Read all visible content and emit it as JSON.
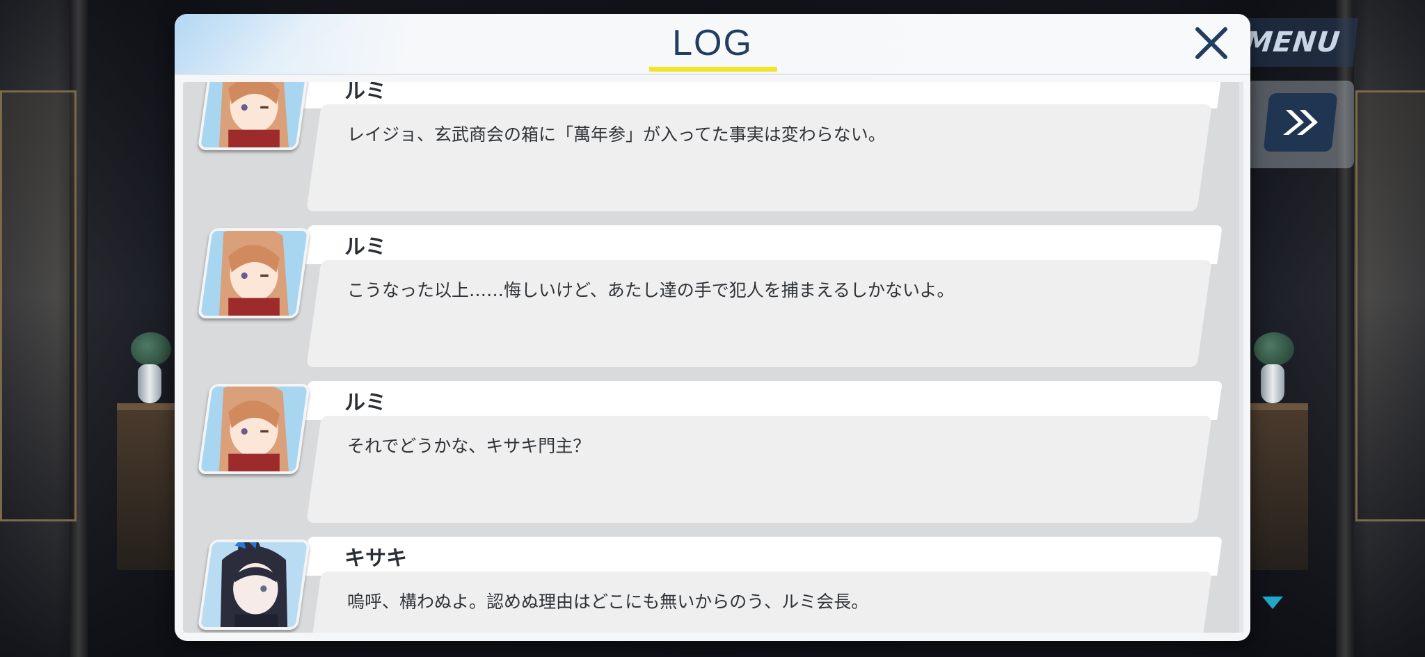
{
  "scene": {
    "background": "dimmed palace interior"
  },
  "hud": {
    "menu_label": "MENU",
    "fast_forward_icon": "double-chevron-right-icon",
    "scroll_indicator_icon": "triangle-down-icon"
  },
  "log": {
    "title": "LOG",
    "close_icon": "close-icon",
    "accent_color": "#f3e32c",
    "title_color": "#223e5f",
    "entries": [
      {
        "speaker": "ルミ",
        "message": "レイジョ、玄武商会の箱に「萬年参」が入ってた事実は変わらない。"
      },
      {
        "speaker": "ルミ",
        "message": "こうなった以上……悔しいけど、あたし達の手で犯人を捕まえるしかないよ。"
      },
      {
        "speaker": "ルミ",
        "message": "それでどうかな、キサキ門主？"
      },
      {
        "speaker": "キサキ",
        "message": "嗚呼、構わぬよ。認めぬ理由はどこにも無いからのう、ルミ会長。"
      }
    ]
  }
}
